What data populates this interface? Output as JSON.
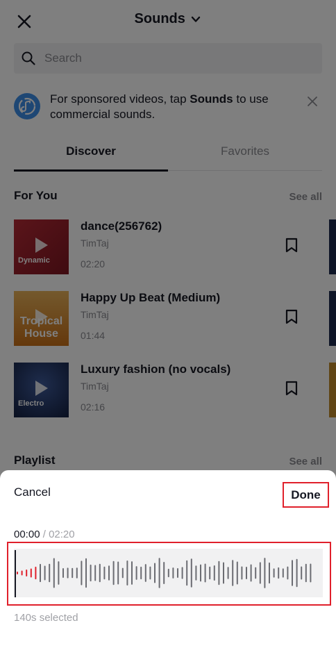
{
  "header": {
    "title": "Sounds"
  },
  "search": {
    "placeholder": "Search"
  },
  "banner": {
    "text_before": "For sponsored videos, tap ",
    "text_bold": "Sounds",
    "text_after": " to use commercial sounds."
  },
  "tabs": [
    {
      "label": "Discover"
    },
    {
      "label": "Favorites"
    }
  ],
  "for_you": {
    "title": "For You",
    "see_all": "See all",
    "tracks": [
      {
        "name": "dance(256762)",
        "artist": "TimTaj",
        "duration": "02:20",
        "cover_label": "Dynamic",
        "cover_color": "#a32230"
      },
      {
        "name": "Happy Up Beat (Medium)",
        "artist": "TimTaj",
        "duration": "01:44",
        "cover_label": "Tropical House",
        "cover_color": "#d98a2a"
      },
      {
        "name": "Luxury fashion (no vocals)",
        "artist": "TimTaj",
        "duration": "02:16",
        "cover_label": "Electro",
        "cover_color": "#233a6e"
      }
    ]
  },
  "playlist": {
    "title": "Playlist",
    "see_all": "See all"
  },
  "sheet": {
    "cancel_label": "Cancel",
    "done_label": "Done",
    "current_time": "00:00",
    "separator": " / ",
    "total_time": "02:20",
    "selected_text": "140s selected"
  },
  "colors": {
    "accent_red": "#e0202b",
    "banner_icon": "#3d8ee8"
  }
}
